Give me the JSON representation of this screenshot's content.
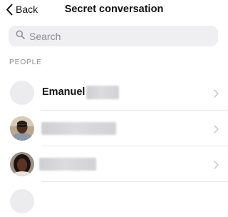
{
  "navbar": {
    "back_label": "Back",
    "title": "Secret conversation"
  },
  "search": {
    "placeholder": "Search"
  },
  "people": {
    "section_label": "PEOPLE",
    "contacts": [
      {
        "name": "Emanuel",
        "avatar": "blank-avatar",
        "name_obscured": true
      },
      {
        "name": "",
        "avatar": "photo-avatar-man",
        "name_obscured": true
      },
      {
        "name": "",
        "avatar": "photo-avatar-woman",
        "name_obscured": true
      },
      {
        "name": "",
        "avatar": "blank-avatar",
        "name_obscured": false
      }
    ]
  },
  "icons": {
    "back": "chevron-left-icon",
    "search": "search-icon",
    "row_disclosure": "chevron-right-icon"
  },
  "colors": {
    "background": "#ffffff",
    "search_field": "#efeff1",
    "secondary_text": "#8e8e93",
    "chevron": "#c7c7cc"
  }
}
